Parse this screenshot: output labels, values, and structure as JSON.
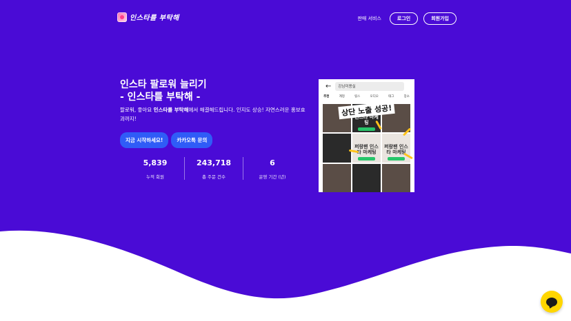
{
  "brand": {
    "logo_text": "인스타를 부탁해"
  },
  "nav": {
    "service": "판매 서비스",
    "login": "로그인",
    "signup": "회원가입"
  },
  "hero": {
    "title_line1": "인스타 팔로워 늘리기",
    "title_line2": "- 인스타를 부탁해 -",
    "desc_part1": "팔로워, 좋아요 ",
    "desc_bold": "인스타를 부탁해",
    "desc_part2": "에서 해결해드립니다. 인지도 상승! 자연스러운 홍보효과까지!",
    "cta_start": "지금 시작하세요!",
    "cta_kakao": "카카오톡 문의"
  },
  "stats": [
    {
      "value": "5,839",
      "label": "누적 회원"
    },
    {
      "value": "243,718",
      "label": "총 주문 건수"
    },
    {
      "value": "6",
      "label": "운영 기간 (년)"
    }
  ],
  "preview": {
    "search_text": "강남미용실",
    "tabs": [
      "추천",
      "계정",
      "릴스",
      "오디오",
      "태그",
      "장소"
    ],
    "banner": "상단 노출 성공!",
    "cells": [
      "인스타 마케팅",
      "",
      "",
      "",
      "퍼랑팬 인스타 마케팅",
      "퍼랑팬 인스타 마케팅",
      "",
      "",
      ""
    ]
  },
  "colors": {
    "hero_bg": "#4a0bd6",
    "cta_bg": "#2f5cf7",
    "chat_bg": "#ffd600"
  },
  "icons": {
    "chat": "kakao-chat-icon",
    "back": "arrow-left-icon",
    "logo": "app-logo-icon"
  }
}
